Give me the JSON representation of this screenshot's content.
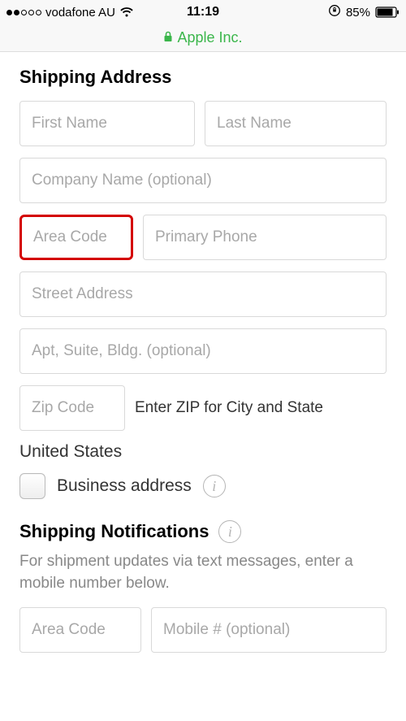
{
  "status": {
    "carrier": "vodafone AU",
    "time": "11:19",
    "battery": "85%"
  },
  "url_bar": {
    "site": "Apple Inc."
  },
  "shipping_address": {
    "title": "Shipping Address",
    "first_name_placeholder": "First Name",
    "last_name_placeholder": "Last Name",
    "company_placeholder": "Company Name (optional)",
    "area_code_placeholder": "Area Code",
    "primary_phone_placeholder": "Primary Phone",
    "street_placeholder": "Street Address",
    "apt_placeholder": "Apt, Suite, Bldg. (optional)",
    "zip_placeholder": "Zip Code",
    "zip_hint": "Enter ZIP for City and State",
    "country": "United States",
    "business_label": "Business address"
  },
  "notifications": {
    "title": "Shipping Notifications",
    "description": "For shipment updates via text messages, enter a mobile number below.",
    "area_code_placeholder": "Area Code",
    "mobile_placeholder": "Mobile # (optional)"
  },
  "info_glyph": "i"
}
